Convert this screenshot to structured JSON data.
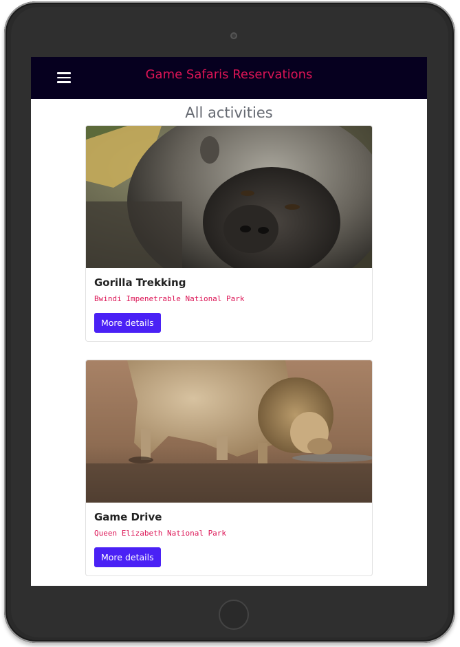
{
  "app": {
    "title": "Game Safaris Reservations"
  },
  "navbar": {
    "menu_icon": "hamburger-menu-icon"
  },
  "page": {
    "heading": "All activities"
  },
  "activities": [
    {
      "title": "Gorilla Trekking",
      "location": "Bwindi Impenetrable National Park",
      "button_label": "More details",
      "image": "gorilla-photo"
    },
    {
      "title": "Game Drive",
      "location": "Queen Elizabeth National Park",
      "button_label": "More details",
      "image": "lion-photo"
    }
  ],
  "colors": {
    "navbar_bg": "#06001f",
    "brand": "#dc1455",
    "button": "#4a21f5",
    "subtitle": "#dc1455"
  }
}
